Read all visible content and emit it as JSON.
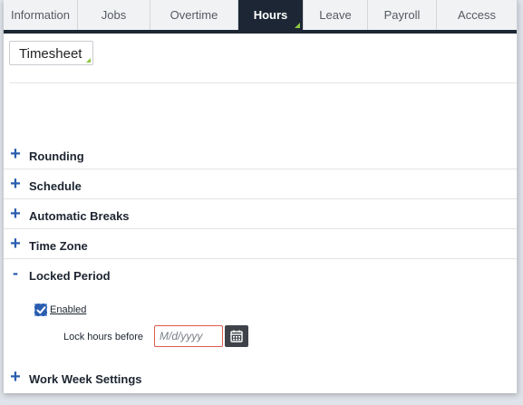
{
  "tabs": [
    {
      "label": "Information"
    },
    {
      "label": "Jobs"
    },
    {
      "label": "Overtime"
    },
    {
      "label": "Hours"
    },
    {
      "label": "Leave"
    },
    {
      "label": "Payroll"
    },
    {
      "label": "Access"
    }
  ],
  "active_tab": "Hours",
  "subtab": {
    "label": "Timesheet"
  },
  "sections": [
    {
      "label": "Rounding",
      "sign": "+"
    },
    {
      "label": "Schedule",
      "sign": "+"
    },
    {
      "label": "Automatic Breaks",
      "sign": "+"
    },
    {
      "label": "Time Zone",
      "sign": "+"
    },
    {
      "label": "Locked Period",
      "sign": "-"
    },
    {
      "label": "Work Week Settings",
      "sign": "+"
    }
  ],
  "locked_period": {
    "enabled_label": "Enabled",
    "enabled_checked": true,
    "lock_label": "Lock hours before",
    "date_placeholder": "M/d/yyyy",
    "date_value": ""
  },
  "colors": {
    "accent": "#2a5db0",
    "tab_active_bg": "#1c2634",
    "corner_marker": "#8cc63f",
    "input_error_border": "#e05a4f"
  },
  "icons": {
    "checkbox": "checkmark-icon",
    "calendar": "calendar-icon"
  }
}
